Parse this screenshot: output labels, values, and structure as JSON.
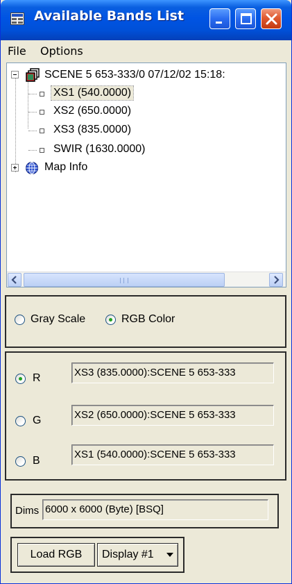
{
  "window": {
    "title": "Available Bands List",
    "colors": {
      "titlebar": "#0054e3",
      "close_button": "#e05a30",
      "face": "#ece9d8",
      "radio_dot": "#21a121"
    }
  },
  "menu": {
    "items": [
      "File",
      "Options"
    ]
  },
  "tree": {
    "root": {
      "label": "SCENE 5 653-333/0 07/12/02 15:18:",
      "icon": "scene-stack-icon",
      "expanded": true
    },
    "bands": [
      {
        "label": "XS1 (540.0000)",
        "selected": true
      },
      {
        "label": "XS2 (650.0000)",
        "selected": false
      },
      {
        "label": "XS3 (835.0000)",
        "selected": false
      },
      {
        "label": "SWIR (1630.0000)",
        "selected": false
      }
    ],
    "map_info": {
      "label": "Map Info",
      "icon": "globe-icon",
      "expanded": false
    }
  },
  "mode": {
    "gray_scale_label": "Gray Scale",
    "rgb_color_label": "RGB Color",
    "selected": "RGB Color"
  },
  "rgb": {
    "channels": [
      {
        "label": "R",
        "value": "XS3 (835.0000):SCENE 5 653-333",
        "checked": true
      },
      {
        "label": "G",
        "value": "XS2 (650.0000):SCENE 5 653-333",
        "checked": false
      },
      {
        "label": "B",
        "value": "XS1 (540.0000):SCENE 5 653-333",
        "checked": false
      }
    ]
  },
  "dims": {
    "label": "Dims",
    "value": "6000 x 6000 (Byte) [BSQ]"
  },
  "actions": {
    "load_label": "Load RGB",
    "display_label": "Display #1"
  }
}
